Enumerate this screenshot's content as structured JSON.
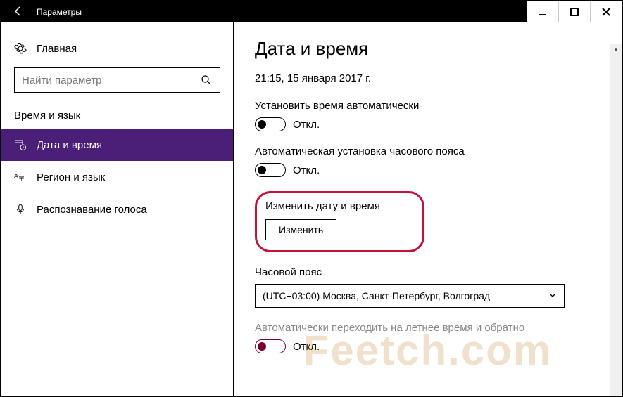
{
  "titlebar": {
    "title": "Параметры"
  },
  "sidebar": {
    "home": "Главная",
    "search_placeholder": "Найти параметр",
    "section": "Время и язык",
    "items": [
      {
        "label": "Дата и время"
      },
      {
        "label": "Регион и язык"
      },
      {
        "label": "Распознавание голоса"
      }
    ]
  },
  "content": {
    "heading": "Дата и время",
    "now": "21:15, 15 января 2017 г.",
    "auto_time_label": "Установить время автоматически",
    "auto_time_state": "Откл.",
    "auto_tz_label": "Автоматическая установка часового пояса",
    "auto_tz_state": "Откл.",
    "change_dt_label": "Изменить дату и время",
    "change_btn": "Изменить",
    "tz_label": "Часовой пояс",
    "tz_value": "(UTC+03:00) Москва, Санкт-Петербург, Волгоград",
    "dst_label": "Автоматически переходить на летнее время и обратно",
    "dst_state": "Откл."
  },
  "watermark": "Feetch.com"
}
